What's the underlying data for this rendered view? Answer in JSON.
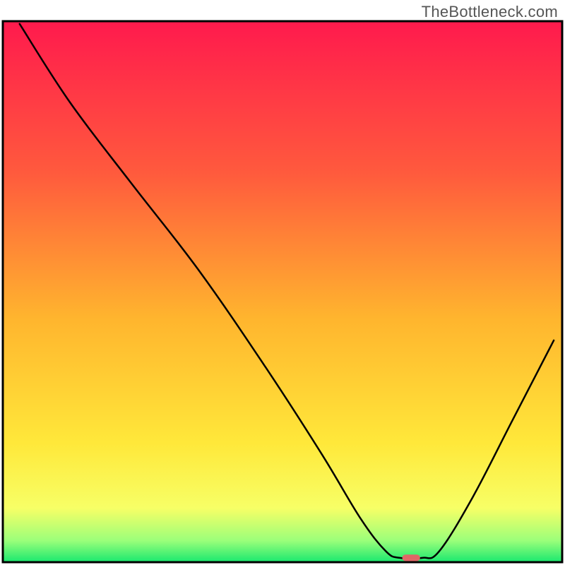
{
  "watermark": "TheBottleneck.com",
  "chart_data": {
    "type": "line",
    "title": "",
    "xlabel": "",
    "ylabel": "",
    "xlim": [
      0,
      100
    ],
    "ylim": [
      0,
      100
    ],
    "grid": false,
    "legend": false,
    "background": {
      "type": "vertical-gradient",
      "stops": [
        {
          "offset": 0.0,
          "color": "#ff1a4d"
        },
        {
          "offset": 0.28,
          "color": "#ff5a3d"
        },
        {
          "offset": 0.55,
          "color": "#ffb52e"
        },
        {
          "offset": 0.78,
          "color": "#ffe83a"
        },
        {
          "offset": 0.9,
          "color": "#f7ff66"
        },
        {
          "offset": 0.96,
          "color": "#9bff7a"
        },
        {
          "offset": 1.0,
          "color": "#19e86f"
        }
      ]
    },
    "series": [
      {
        "name": "bottleneck-curve",
        "color": "#000000",
        "width": 2.5,
        "points": [
          {
            "x": 3.0,
            "y": 99.5
          },
          {
            "x": 12.0,
            "y": 85.0
          },
          {
            "x": 23.0,
            "y": 70.0
          },
          {
            "x": 35.0,
            "y": 54.0
          },
          {
            "x": 47.0,
            "y": 36.0
          },
          {
            "x": 57.0,
            "y": 20.0
          },
          {
            "x": 64.0,
            "y": 8.0
          },
          {
            "x": 68.5,
            "y": 2.0
          },
          {
            "x": 71.0,
            "y": 0.8
          },
          {
            "x": 75.0,
            "y": 0.8
          },
          {
            "x": 78.0,
            "y": 2.0
          },
          {
            "x": 84.0,
            "y": 12.0
          },
          {
            "x": 91.0,
            "y": 26.0
          },
          {
            "x": 98.5,
            "y": 41.0
          }
        ]
      }
    ],
    "marker": {
      "name": "optimal-marker",
      "color": "#e06666",
      "x": 73.0,
      "y": 0.8,
      "rx": 3.2,
      "ry": 1.2
    },
    "frame": {
      "color": "#000000",
      "width": 3
    }
  }
}
